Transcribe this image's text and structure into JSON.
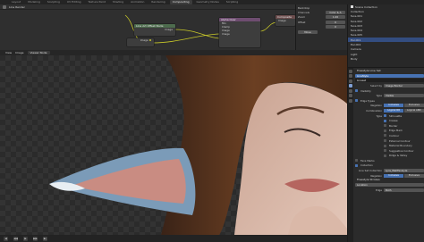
{
  "workspace_tabs": [
    "Layout",
    "Modeling",
    "Sculpting",
    "UV Editing",
    "Texture Paint",
    "Shading",
    "Animation",
    "Rendering",
    "Compositing",
    "Geometry Nodes",
    "Scripting"
  ],
  "node_editor": {
    "header_items": [
      "Line Render"
    ],
    "nodes": {
      "image_node": {
        "title": "",
        "outputs": [
          "Image"
        ]
      },
      "alpha_node": {
        "title": "Alpha Over",
        "rows": [
          "Mix",
          "Clamp",
          "Image",
          "Image"
        ]
      },
      "lineart_node": {
        "title": "Line Art Offset Node",
        "rows": [
          "Image"
        ]
      },
      "composite_node": {
        "title": "Composite",
        "rows": [
          "Image"
        ]
      }
    },
    "side_props": [
      {
        "label": "Backdrop",
        "value": ""
      },
      {
        "label": "Channels",
        "value": "Color & A"
      },
      {
        "label": "Zoom",
        "value": "1.00"
      },
      {
        "label": "Offset",
        "value": "0"
      },
      {
        "label": "",
        "value": "0"
      },
      {
        "label": "Move",
        "value": ""
      }
    ]
  },
  "viewport": {
    "mode_label": "Viewer Node",
    "header_items": [
      "View",
      "Image"
    ]
  },
  "outliner": {
    "title": "Scene Collection",
    "rows": [
      "Collection",
      "face.001",
      "face.002",
      "face.003",
      "face.004",
      "face.005",
      "Ear.001",
      "Ear.002",
      "Camera",
      "Light",
      "Body"
    ]
  },
  "properties": {
    "panels": [
      {
        "head": "Freestyle Line Set"
      },
      {
        "head": "Freestyle Line Style"
      }
    ],
    "rows": [
      {
        "label": "",
        "value": "LineStyle"
      },
      {
        "label": "",
        "value": "Lineset"
      },
      {
        "label": "Select by",
        "value": "Image Border"
      },
      {
        "label": "",
        "check": "Visibility"
      },
      {
        "label": "Type",
        "value": "Visible"
      },
      {
        "label": "",
        "check": "Edge Types"
      },
      {
        "label": "Negation",
        "seg": [
          "Inclusive",
          "Exclusive"
        ]
      },
      {
        "label": "Combination",
        "seg": [
          "Logical OR",
          "Logical AND"
        ]
      },
      {
        "label": "Type",
        "check": "Silhouette"
      },
      {
        "label": "",
        "check": "Crease"
      },
      {
        "label": "",
        "check": "Border"
      },
      {
        "label": "",
        "check": "Edge Mark"
      },
      {
        "label": "",
        "check": "Contour"
      },
      {
        "label": "",
        "check": "External Contour"
      },
      {
        "label": "",
        "check": "Material Boundary"
      },
      {
        "label": "",
        "check": "Suggestive Contour"
      },
      {
        "label": "",
        "check": "Ridge & Valley"
      },
      {
        "label": "",
        "check": "Face Marks"
      },
      {
        "label": "",
        "check": "Collection"
      },
      {
        "label": "Line Set Collection",
        "value": "Lyra_WallFacelyle"
      },
      {
        "label": "Negation",
        "seg": [
          "Inclusive",
          "Exclusive"
        ]
      },
      {
        "label": "",
        "value": "Freestyle Strokes"
      },
      {
        "label": "",
        "value": "Location"
      },
      {
        "label": "Edge",
        "value": "Both"
      }
    ]
  },
  "statusbar": {
    "buttons": [
      "◀",
      "◀◀",
      "▶",
      "▶▶",
      "▶|"
    ]
  },
  "colors": {
    "accent": "#4772b3",
    "socket": "#c7c729"
  }
}
